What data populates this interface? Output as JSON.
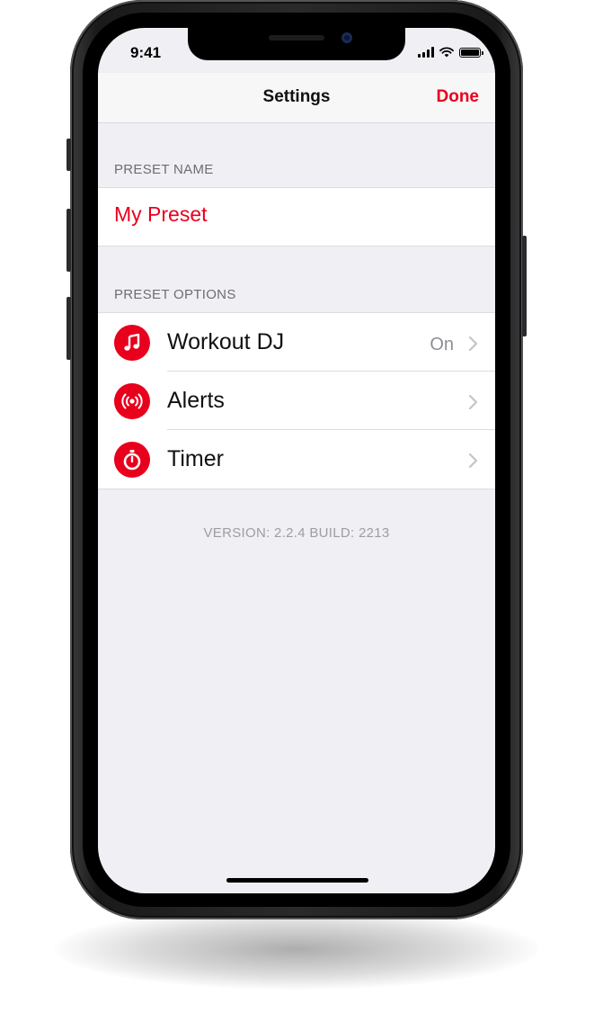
{
  "status_bar": {
    "time": "9:41",
    "icons": [
      "signal-icon",
      "wifi-icon",
      "battery-icon"
    ]
  },
  "nav": {
    "title": "Settings",
    "done_label": "Done"
  },
  "sections": {
    "preset_name": {
      "header": "PRESET NAME",
      "value": "My Preset"
    },
    "preset_options": {
      "header": "PRESET OPTIONS",
      "rows": [
        {
          "label": "Workout DJ",
          "detail": "On",
          "icon": "music-note-icon"
        },
        {
          "label": "Alerts",
          "detail": "",
          "icon": "broadcast-icon"
        },
        {
          "label": "Timer",
          "detail": "",
          "icon": "stopwatch-icon"
        }
      ]
    }
  },
  "footer": {
    "version": "VERSION: 2.2.4 BUILD: 2213"
  },
  "colors": {
    "accent": "#e8001c",
    "background": "#efeff4",
    "secondary_text": "#8e8e93"
  }
}
